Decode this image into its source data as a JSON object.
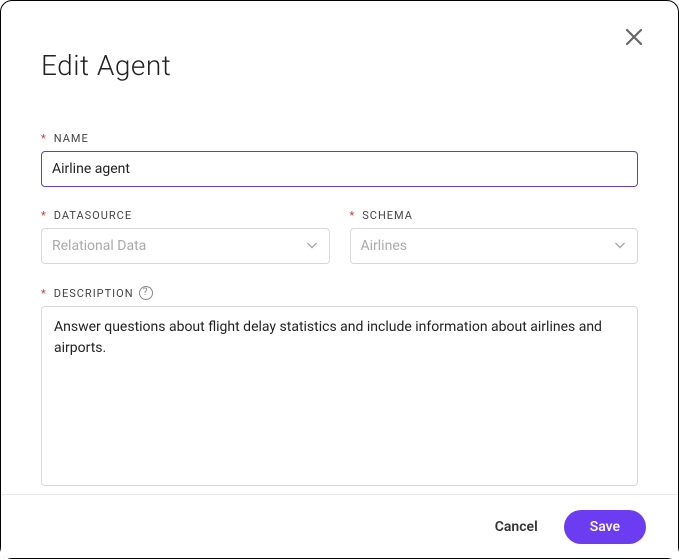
{
  "modal": {
    "title": "Edit Agent"
  },
  "fields": {
    "name": {
      "label": "NAME",
      "value": "Airline agent"
    },
    "datasource": {
      "label": "DATASOURCE",
      "value": "Relational Data"
    },
    "schema": {
      "label": "SCHEMA",
      "value": "Airlines"
    },
    "description": {
      "label": "DESCRIPTION",
      "value": "Answer questions about flight delay statistics and include information about airlines and airports."
    }
  },
  "footer": {
    "cancel": "Cancel",
    "save": "Save"
  }
}
